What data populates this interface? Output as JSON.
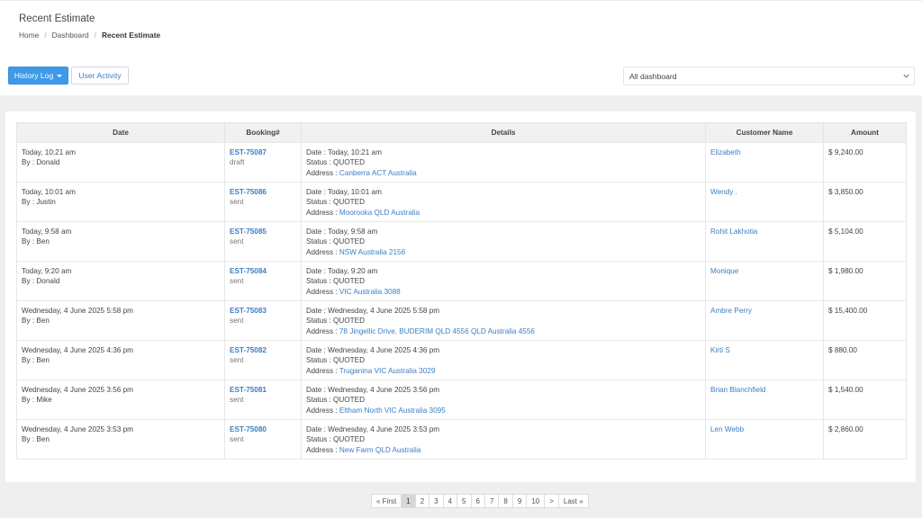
{
  "page": {
    "title": "Recent Estimate"
  },
  "breadcrumb": {
    "home": "Home",
    "sep": "/",
    "dashboard": "Dashboard",
    "current": "Recent Estimate"
  },
  "toolbar": {
    "history_label": "History Log",
    "activity_label": "User Activity",
    "select_value": "All dashboard"
  },
  "colors": {
    "accent": "#3d9be9",
    "link": "#3b7fc4"
  },
  "table": {
    "headers": [
      "Date",
      "Booking#",
      "Details",
      "Customer Name",
      "Amount"
    ],
    "rows": [
      {
        "date": "Today, 10:21 am",
        "by": "By : Donald",
        "booking": "EST-75087",
        "state": "draft",
        "detail_date": "Date : Today, 10:21 am",
        "status": "Status : QUOTED",
        "address_label": "Address : ",
        "address": "Canberra ACT Australia",
        "customer": "Elizabeth",
        "amount": "$ 9,240.00"
      },
      {
        "date": "Today, 10:01 am",
        "by": "By : Justin",
        "booking": "EST-75086",
        "state": "sent",
        "detail_date": "Date : Today, 10:01 am",
        "status": "Status : QUOTED",
        "address_label": "Address : ",
        "address": "Moorooka QLD Australia",
        "customer": "Wendy .",
        "amount": "$ 3,850.00"
      },
      {
        "date": "Today, 9:58 am",
        "by": "By : Ben",
        "booking": "EST-75085",
        "state": "sent",
        "detail_date": "Date : Today, 9:58 am",
        "status": "Status : QUOTED",
        "address_label": "Address : ",
        "address": "NSW Australia 2156",
        "customer": "Rohit Lakhotia",
        "amount": "$ 5,104.00"
      },
      {
        "date": "Today, 9:20 am",
        "by": "By : Donald",
        "booking": "EST-75084",
        "state": "sent",
        "detail_date": "Date : Today, 9:20 am",
        "status": "Status : QUOTED",
        "address_label": "Address : ",
        "address": "VIC Australia 3088",
        "customer": "Monique",
        "amount": "$ 1,980.00"
      },
      {
        "date": "Wednesday, 4 June 2025 5:58 pm",
        "by": "By : Ben",
        "booking": "EST-75083",
        "state": "sent",
        "detail_date": "Date : Wednesday, 4 June 2025 5:58 pm",
        "status": "Status : QUOTED",
        "address_label": "Address : ",
        "address": "78 Jingellic Drive, BUDERIM QLD 4556 QLD Australia 4556",
        "customer": "Ambre Perry",
        "amount": "$ 15,400.00"
      },
      {
        "date": "Wednesday, 4 June 2025 4:36 pm",
        "by": "By : Ben",
        "booking": "EST-75082",
        "state": "sent",
        "detail_date": "Date : Wednesday, 4 June 2025 4:36 pm",
        "status": "Status : QUOTED",
        "address_label": "Address : ",
        "address": "Truganina VIC Australia 3029",
        "customer": "Kirti S",
        "amount": "$ 880.00"
      },
      {
        "date": "Wednesday, 4 June 2025 3:56 pm",
        "by": "By : Mike",
        "booking": "EST-75081",
        "state": "sent",
        "detail_date": "Date : Wednesday, 4 June 2025 3:56 pm",
        "status": "Status : QUOTED",
        "address_label": "Address : ",
        "address": "Eltham North VIC Australia 3095",
        "customer": "Brian Blanchfield",
        "amount": "$ 1,540.00"
      },
      {
        "date": "Wednesday, 4 June 2025 3:53 pm",
        "by": "By : Ben",
        "booking": "EST-75080",
        "state": "sent",
        "detail_date": "Date : Wednesday, 4 June 2025 3:53 pm",
        "status": "Status : QUOTED",
        "address_label": "Address : ",
        "address": "New Farm QLD Australia",
        "customer": "Len Webb",
        "amount": "$ 2,860.00"
      }
    ]
  },
  "pagination": {
    "first": "« First",
    "next": ">",
    "last": "Last »",
    "pages": [
      "1",
      "2",
      "3",
      "4",
      "5",
      "6",
      "7",
      "8",
      "9",
      "10"
    ],
    "current": "1"
  }
}
